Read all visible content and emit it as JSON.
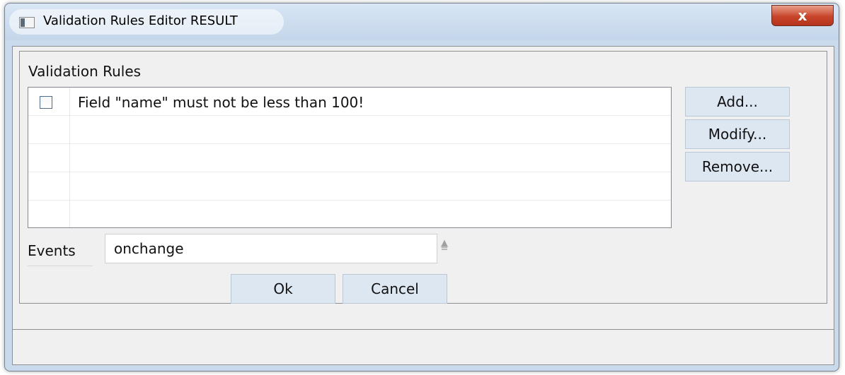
{
  "window": {
    "title": "Validation Rules Editor RESULT",
    "close_glyph": "x"
  },
  "group": {
    "label": "Validation Rules"
  },
  "rules": [
    {
      "text": "Field \"name\" must not be less than 100!",
      "checked": false
    },
    {
      "text": "",
      "checked": false
    },
    {
      "text": "",
      "checked": false
    },
    {
      "text": "",
      "checked": false
    },
    {
      "text": "",
      "checked": false
    }
  ],
  "buttons": {
    "add": "Add...",
    "modify": "Modify...",
    "remove": "Remove...",
    "ok": "Ok",
    "cancel": "Cancel"
  },
  "events": {
    "label": "Events",
    "value": "onchange"
  }
}
